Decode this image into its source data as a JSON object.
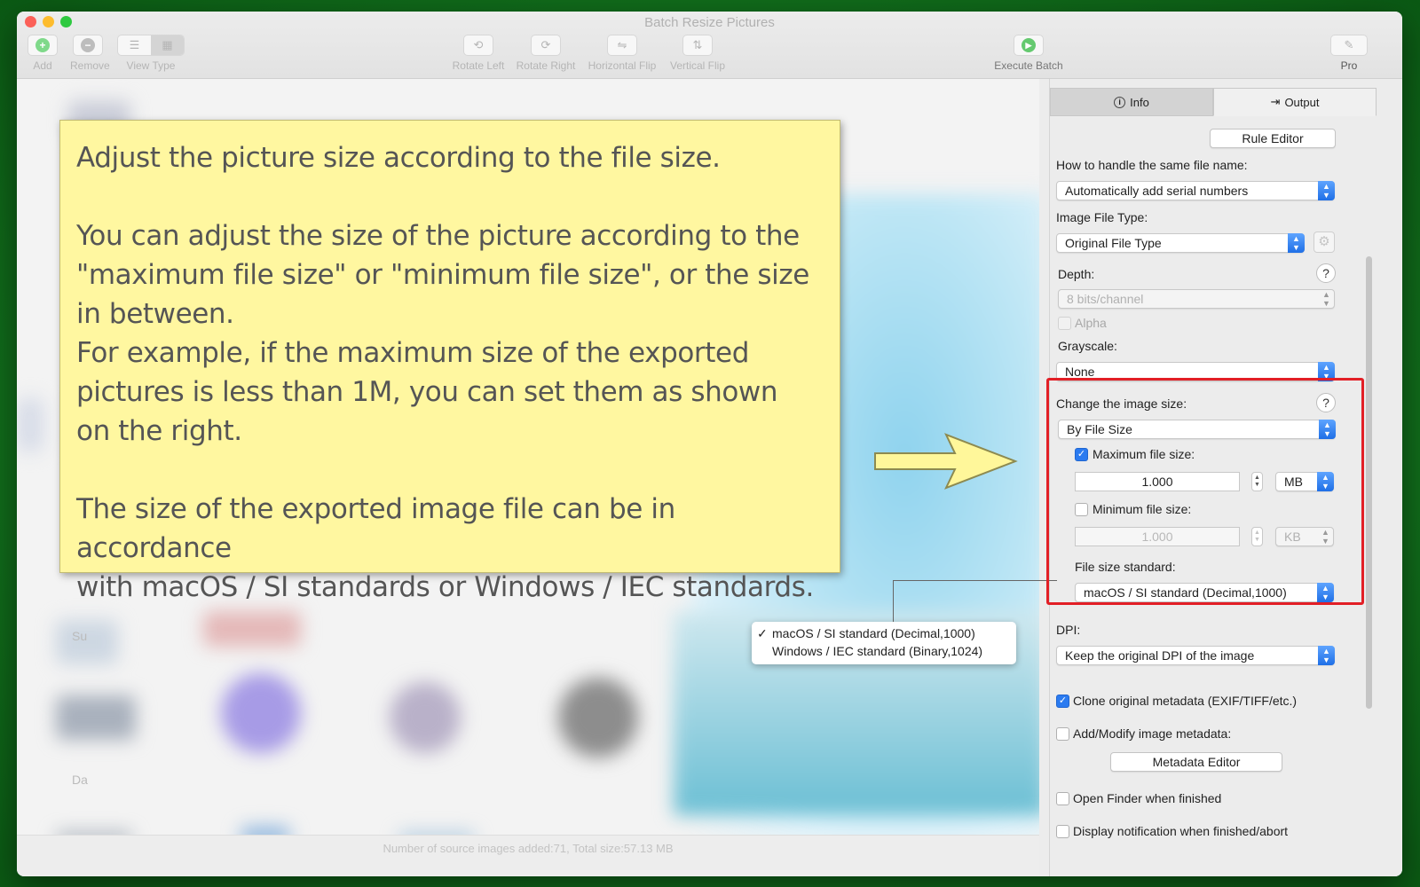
{
  "window": {
    "title": "Batch Resize Pictures"
  },
  "toolbar": {
    "add_label": "Add",
    "remove_label": "Remove",
    "view_type_label": "View Type",
    "rotate_left_label": "Rotate Left",
    "rotate_right_label": "Rotate Right",
    "horizontal_flip_label": "Horizontal Flip",
    "vertical_flip_label": "Vertical Flip",
    "execute_batch_label": "Execute Batch",
    "pro_label": "Pro"
  },
  "status": {
    "text": "Number of source images added:71, Total size:57.13 MB"
  },
  "note": {
    "line1": "Adjust the picture size according to the file size.",
    "para2": "You can adjust the size of the picture according to the\n\"maximum file size\" or \"minimum file size\", or the size\nin between.\nFor example, if the maximum size of the exported\npictures is less than 1M, you can set them as shown\non the right.",
    "para3": "The size of the exported image file can be in accordance\nwith macOS / SI standards or Windows / IEC standards."
  },
  "popup": {
    "options": [
      "macOS / SI standard (Decimal,1000)",
      "Windows / IEC standard (Binary,1024)"
    ],
    "checkmark": "✓"
  },
  "blurred_labels": {
    "label_a": "Su",
    "label_b": "Da"
  },
  "panel": {
    "tabs": {
      "info": "Info",
      "output": "Output"
    },
    "rule_editor": "Rule Editor",
    "same_name_label": "How to handle the same file name:",
    "same_name_value": "Automatically add serial numbers",
    "file_type_label": "Image File Type:",
    "file_type_value": "Original File Type",
    "depth_label": "Depth:",
    "depth_value": "8 bits/channel",
    "alpha_label": "Alpha",
    "grayscale_label": "Grayscale:",
    "grayscale_value": "None",
    "change_size_label": "Change the image size:",
    "change_size_value": "By File Size",
    "max_label": "Maximum file size:",
    "max_value": "1.000",
    "max_unit": "MB",
    "min_label": "Minimum file size:",
    "min_value": "1.000",
    "min_unit": "KB",
    "standard_label": "File size standard:",
    "standard_value": "macOS / SI standard (Decimal,1000)",
    "dpi_label": "DPI:",
    "dpi_value": "Keep the original DPI of the image",
    "clone_label": "Clone original metadata (EXIF/TIFF/etc.)",
    "modify_label": "Add/Modify image metadata:",
    "metadata_editor": "Metadata Editor",
    "open_finder_label": "Open Finder when finished",
    "notify_label": "Display notification when finished/abort",
    "help_glyph": "?"
  },
  "colors": {
    "accent": "#2b7bf0",
    "highlight": "#e21f26",
    "note": "#fff7a0"
  }
}
